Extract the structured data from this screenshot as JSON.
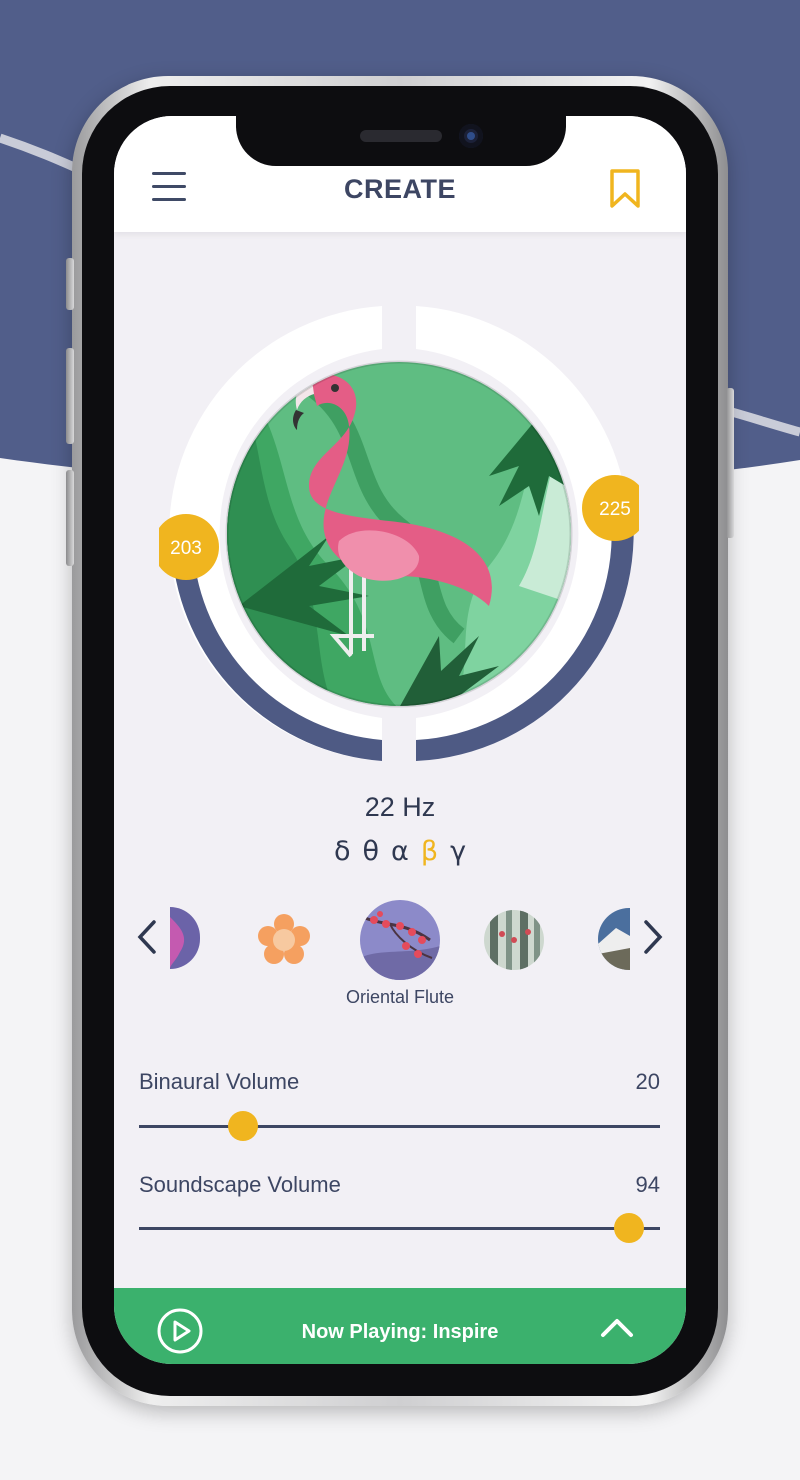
{
  "header": {
    "title": "CREATE",
    "menu_icon": "hamburger-menu-icon",
    "bookmark_icon": "bookmark-icon"
  },
  "dial": {
    "left_value": "203",
    "right_value": "225",
    "artwork": "flamingo-artwork"
  },
  "frequency": {
    "value": "22 Hz"
  },
  "bands": [
    {
      "label": "δ",
      "active": false
    },
    {
      "label": "θ",
      "active": false
    },
    {
      "label": "α",
      "active": false
    },
    {
      "label": "β",
      "active": true
    },
    {
      "label": "γ",
      "active": false
    }
  ],
  "soundscapes": {
    "selected_label": "Oriental Flute"
  },
  "sliders": {
    "binaural": {
      "label": "Binaural Volume",
      "value": "20",
      "level": 0.2
    },
    "soundscape": {
      "label": "Soundscape Volume",
      "value": "94",
      "level": 0.94
    }
  },
  "player": {
    "now_playing": "Now Playing: Inspire"
  },
  "colors": {
    "accent": "#f0b51f",
    "navy": "#4e5a84",
    "green": "#3bb16d",
    "text": "#3d4663"
  }
}
